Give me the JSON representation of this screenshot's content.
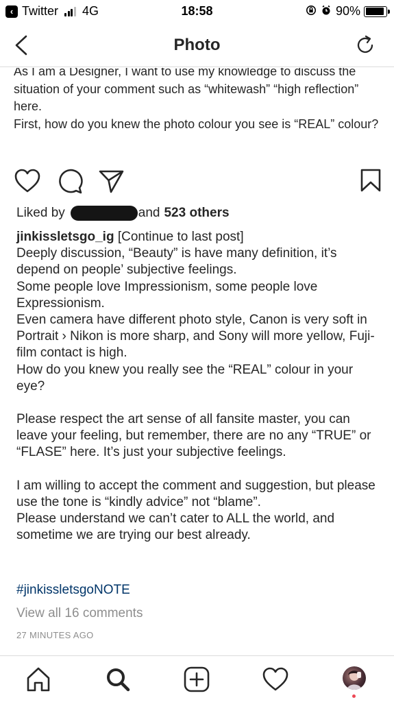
{
  "status_bar": {
    "back_app": "Twitter",
    "network": "4G",
    "time": "18:58",
    "battery_percent": "90%",
    "battery_level": 0.9
  },
  "nav": {
    "title": "Photo"
  },
  "caption_top": "As I am a Designer, I want to use my knowledge to discuss the situation of your comment such as “whitewash” “high reflection” here.\nFirst, how do you knew the photo colour you see is “REAL” colour?",
  "likes": {
    "prefix": "Liked by",
    "suffix": "and",
    "others": "523 others"
  },
  "post": {
    "username": "jinkissletsgo_ig",
    "lead": "[Continue to last post]",
    "paragraphs": [
      "Deeply discussion, “Beauty” is have many definition, it’s depend on people’ subjective feelings.",
      "Some people love Impressionism, some people love Expressionism.",
      "Even camera have different photo style, Canon is very soft in Portrait › Nikon is more sharp, and Sony will more yellow, Fuji-film contact is high.",
      "How do you knew you really see the “REAL” colour in your eye?",
      "Please respect the art sense of all fansite master, you can leave your feeling, but remember, there are no any “TRUE” or “FLASE” here. It’s just your subjective feelings.",
      "I am willing to accept the comment and suggestion, but please use the tone is “kindly advice” not “blame”.\nPlease understand we can’t cater to ALL the world, and sometime we are trying our best already."
    ],
    "hashtag": "#jinkissletsgoNOTE",
    "view_all": "View all 16 comments",
    "timestamp": "27 MINUTES AGO"
  },
  "colors": {
    "text": "#262626",
    "muted": "#8e8e8e",
    "hashtag": "#003569",
    "divider": "#dbdbdb",
    "notification": "#ed4956"
  },
  "icons": {
    "actions": [
      "heart-icon",
      "comment-icon",
      "share-icon",
      "bookmark-icon"
    ],
    "tabs": [
      "home-icon",
      "search-icon",
      "add-post-icon",
      "activity-heart-icon",
      "profile-avatar"
    ]
  }
}
